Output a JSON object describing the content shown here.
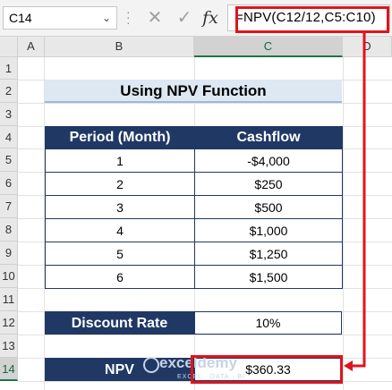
{
  "formula_bar": {
    "name_box": "C14",
    "cancel_icon": "✕",
    "enter_icon": "✓",
    "fx_label": "fx",
    "formula": "=NPV(C12/12,C5:C10)"
  },
  "columns": [
    "A",
    "B",
    "C",
    "D"
  ],
  "rows": [
    "1",
    "2",
    "3",
    "4",
    "5",
    "6",
    "7",
    "8",
    "9",
    "10",
    "11",
    "12",
    "13",
    "14"
  ],
  "title": "Using NPV Function",
  "table": {
    "headers": [
      "Period (Month)",
      "Cashflow"
    ],
    "rows": [
      {
        "period": "1",
        "cashflow": "-$4,000"
      },
      {
        "period": "2",
        "cashflow": "$250"
      },
      {
        "period": "3",
        "cashflow": "$500"
      },
      {
        "period": "4",
        "cashflow": "$1,000"
      },
      {
        "period": "5",
        "cashflow": "$1,250"
      },
      {
        "period": "6",
        "cashflow": "$1,500"
      }
    ]
  },
  "discount": {
    "label": "Discount Rate",
    "value": "10%"
  },
  "npv": {
    "label": "NPV",
    "value": "$360.33"
  },
  "watermark": {
    "name": "exceldemy",
    "tagline": "EXCEL · DATA · BI"
  },
  "colors": {
    "header_fill": "#203864",
    "title_fill": "#dde8f3",
    "highlight": "#e0141e"
  }
}
